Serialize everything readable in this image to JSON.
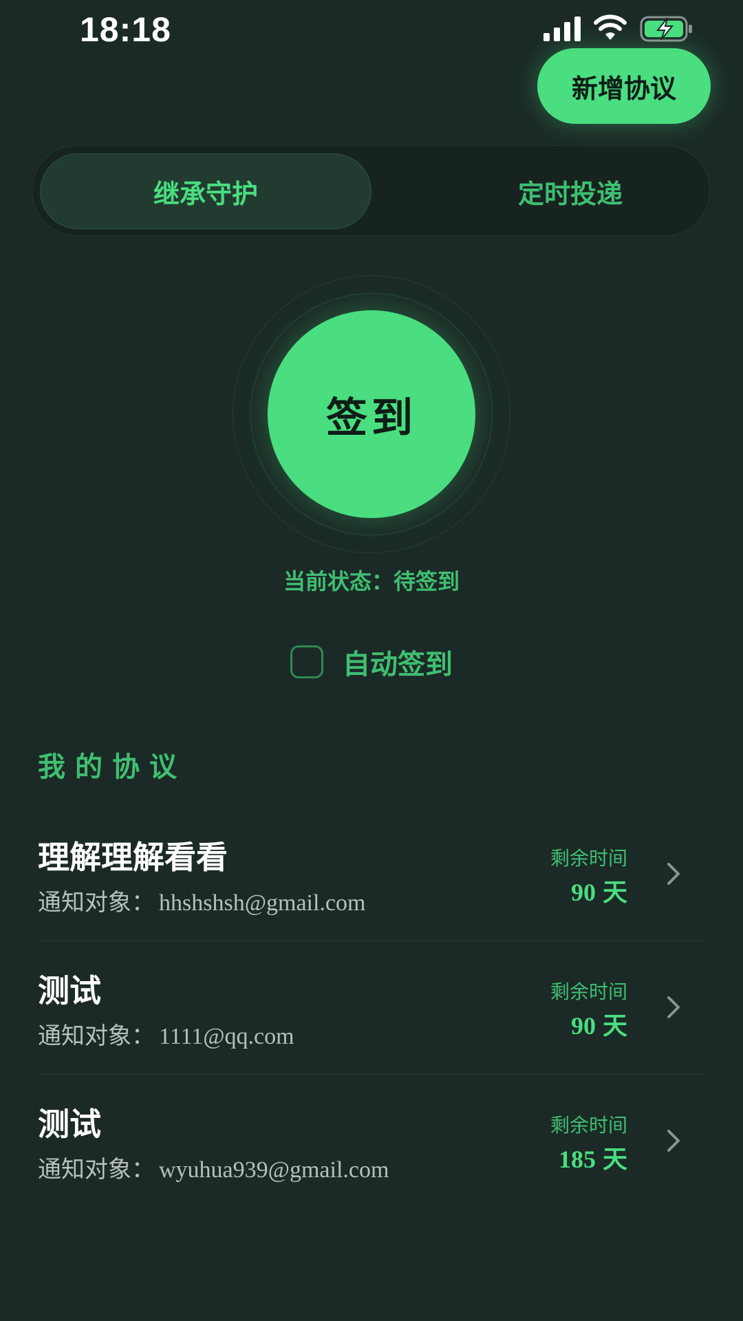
{
  "status_bar": {
    "time": "18:18"
  },
  "header": {
    "add_button_label": "新增协议"
  },
  "tabs": [
    {
      "label": "继承守护",
      "active": true
    },
    {
      "label": "定时投递",
      "active": false
    }
  ],
  "checkin": {
    "button_label": "签到",
    "status_text": "当前状态：待签到"
  },
  "auto_checkin": {
    "label": "自动签到",
    "checked": false
  },
  "section": {
    "title": "我的协议"
  },
  "agreements": [
    {
      "title": "理解理解看看",
      "notify_label": "通知对象：",
      "notify_target": "hhshshsh@gmail.com",
      "remaining_label": "剩余时间",
      "remaining_days": "90",
      "remaining_unit": "天"
    },
    {
      "title": "测试",
      "notify_label": "通知对象：",
      "notify_target": "1111@qq.com",
      "remaining_label": "剩余时间",
      "remaining_days": "90",
      "remaining_unit": "天"
    },
    {
      "title": "测试",
      "notify_label": "通知对象：",
      "notify_target": "wyuhua939@gmail.com",
      "remaining_label": "剩余时间",
      "remaining_days": "185",
      "remaining_unit": "天"
    }
  ],
  "colors": {
    "background": "#1b2a26",
    "accent": "#4ade80",
    "accent_text": "#3fbf72"
  },
  "icons": {
    "signal": "signal-icon",
    "wifi": "wifi-icon",
    "battery": "battery-charging-icon",
    "chevron": "chevron-right-icon"
  }
}
